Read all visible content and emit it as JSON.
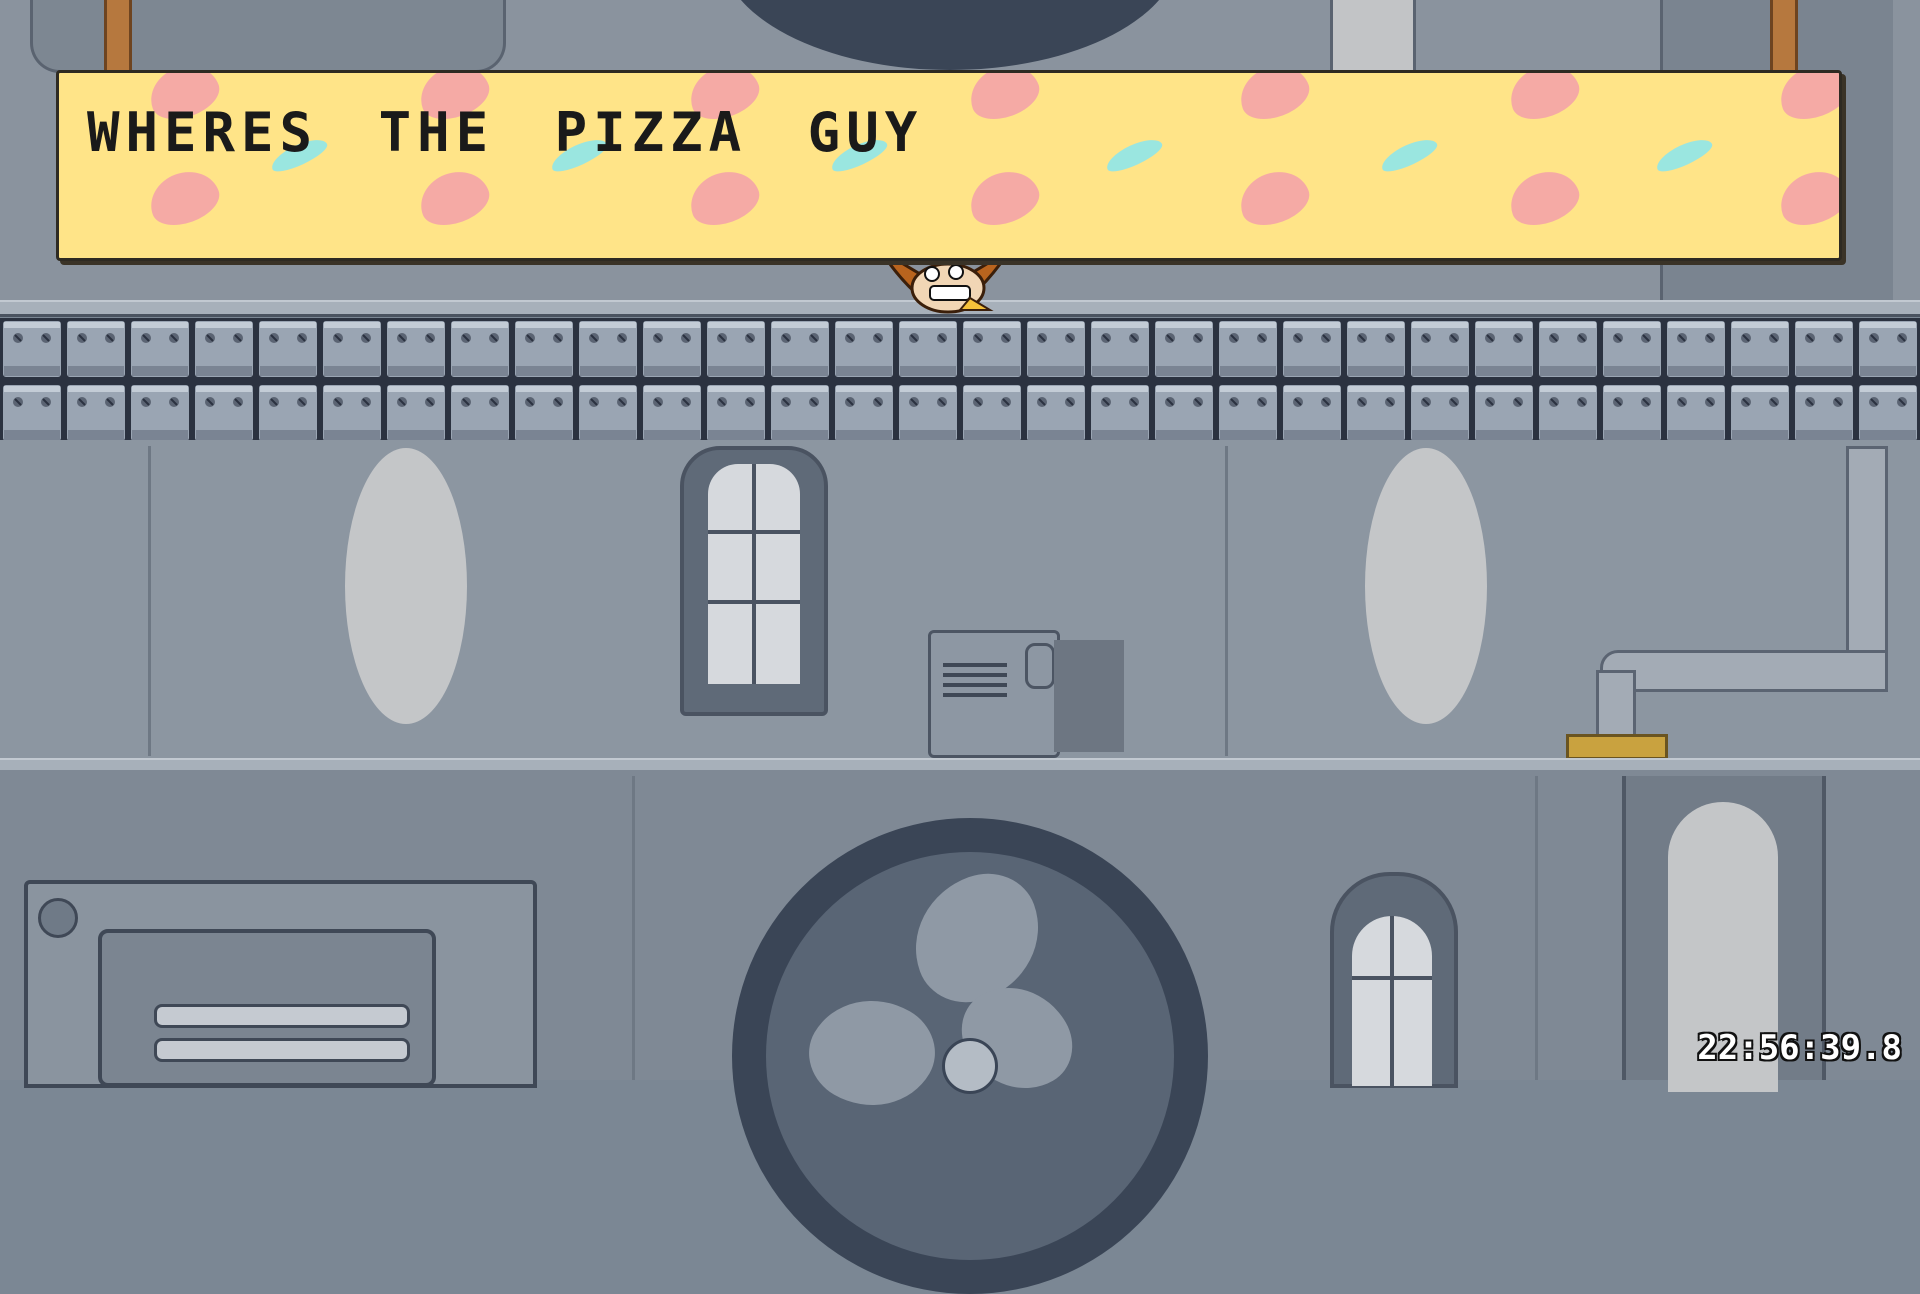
{
  "dialog": {
    "text": "WHERES THE PIZZA GUY"
  },
  "hud": {
    "timer": "22:56:39.8"
  },
  "colors": {
    "banner_bg": "#ffe488",
    "banner_deco_pink": "#f4a3a8",
    "banner_deco_blue": "#8fe6ea",
    "wall": "#8a939e",
    "metal_block": "#9aa5b3"
  },
  "scene": {
    "character": "peppino-peeking",
    "objects": [
      "metal-block-row",
      "oval-window",
      "arched-window",
      "wall-vent",
      "exhaust-pipe",
      "industrial-fan",
      "wall-panel"
    ]
  }
}
